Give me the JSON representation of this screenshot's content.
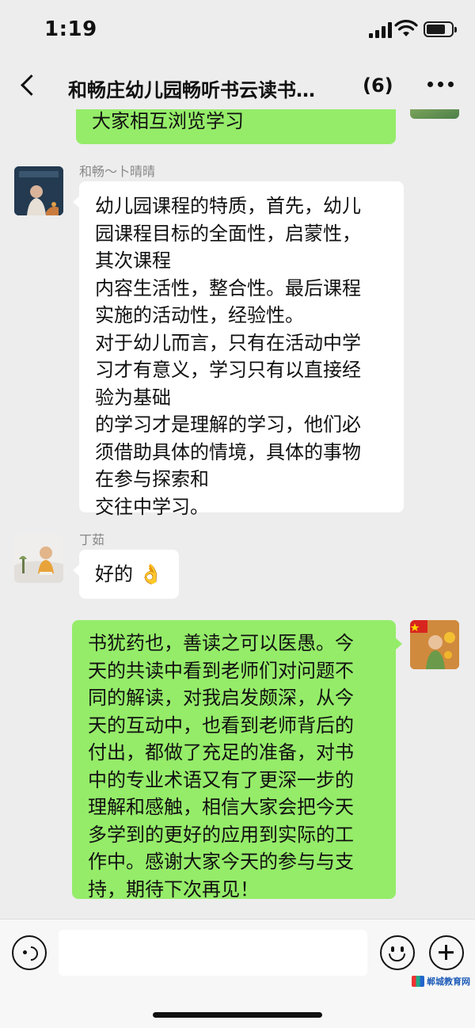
{
  "status_bar": {
    "time": "1:19"
  },
  "nav": {
    "title": "和畅庄幼儿园畅听书云读书…",
    "member_count": "(6)"
  },
  "messages": [
    {
      "sender": "",
      "side": "right",
      "lines": [
        "大家相互浏览学习"
      ]
    },
    {
      "sender": "和畅～卜晴晴",
      "side": "left",
      "lines": [
        "幼儿园课程的特质，首先，幼儿",
        "园课程目标的全面性，启蒙性，",
        "其次课程",
        "内容生活性，整合性。最后课程",
        "实施的活动性，经验性。",
        "对于幼儿而言，只有在活动中学",
        "习才有意义，学习只有以直接经",
        "验为基础",
        "的学习才是理解的学习，他们必",
        "须借助具体的情境，具体的事物",
        "在参与探索和",
        "交往中学习。"
      ]
    },
    {
      "sender": "丁茹",
      "side": "left",
      "lines": [
        "好的 👌"
      ]
    },
    {
      "sender": "",
      "side": "right",
      "lines": [
        "书犹药也，善读之可以医愚。今",
        "天的共读中看到老师们对问题不",
        "同的解读，对我启发颇深，从今",
        "天的互动中，也看到老师背后的",
        "付出，都做了充足的准备，对书",
        "中的专业术语又有了更深一步的",
        "理解和感触，相信大家会把今天",
        "多学到的更好的应用到实际的工",
        "作中。感谢大家今天的参与与支",
        "持，期待下次再见！"
      ]
    }
  ],
  "watermark": {
    "text": "郸城教育网"
  },
  "colors": {
    "bubble_green": "#95ec69",
    "bubble_white": "#ffffff",
    "background": "#ededed"
  }
}
